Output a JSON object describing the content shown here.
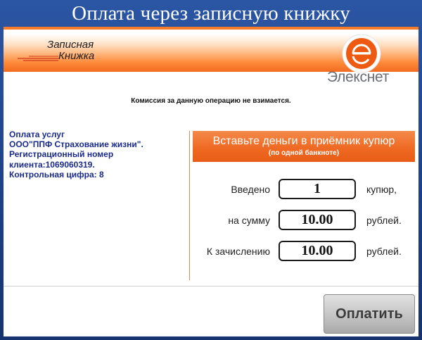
{
  "title": "Оплата через записную книжку",
  "logos": {
    "zapisnaya_line1": "Записная",
    "zapisnaya_line2": "Книжка",
    "brand": "Элекснет"
  },
  "commission_text": "Комиссия за данную операцию не взимается.",
  "payment_info": {
    "line1": "Оплата услуг",
    "line2": "ООО\"ППФ Страхование жизни\".",
    "line3": "Регистрационный номер",
    "line4": "клиента:1069060319.",
    "line5": "Контрольная цифра: 8"
  },
  "insert_banner": {
    "main": "Вставьте деньги в приёмник купюр",
    "sub": "(по одной банкноте)"
  },
  "rows": [
    {
      "label": "Введено",
      "value": "1",
      "unit": "купюр,"
    },
    {
      "label": "на сумму",
      "value": "10.00",
      "unit": "рублей."
    },
    {
      "label": "К зачислению",
      "value": "10.00",
      "unit": "рублей."
    }
  ],
  "pay_button": "Оплатить",
  "colors": {
    "accent_orange": "#ef6a24",
    "title_bg": "#1e3f86",
    "info_text": "#1a2a8a"
  }
}
